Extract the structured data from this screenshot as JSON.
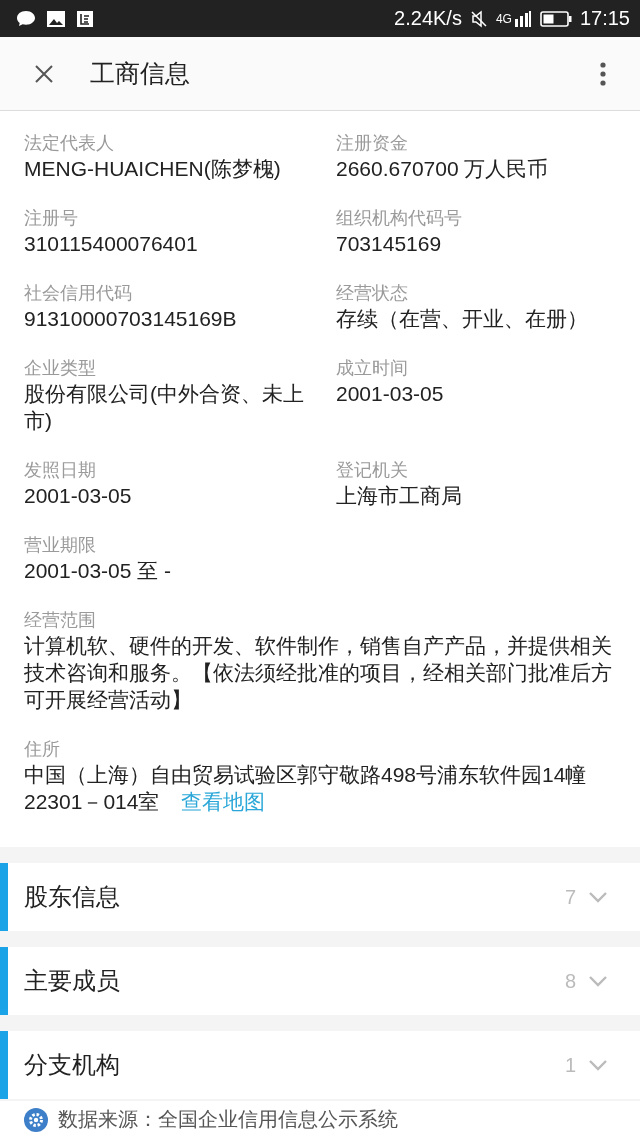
{
  "status_bar": {
    "speed": "2.24K/s",
    "network": "4G",
    "time": "17:15"
  },
  "header": {
    "title": "工商信息"
  },
  "fields": [
    {
      "kind": "half",
      "label": "法定代表人",
      "value": "MENG-HUAICHEN(陈梦槐)"
    },
    {
      "kind": "half",
      "label": "注册资金",
      "value": "2660.670700 万人民币"
    },
    {
      "kind": "half",
      "label": "注册号",
      "value": "310115400076401"
    },
    {
      "kind": "half",
      "label": "组织机构代码号",
      "value": "703145169"
    },
    {
      "kind": "half",
      "label": "社会信用代码",
      "value": "91310000703145169B"
    },
    {
      "kind": "half",
      "label": "经营状态",
      "value": "存续（在营、开业、在册）"
    },
    {
      "kind": "half",
      "label": "企业类型",
      "value": "股份有限公司(中外合资、未上市)"
    },
    {
      "kind": "half",
      "label": "成立时间",
      "value": "2001-03-05"
    },
    {
      "kind": "half",
      "label": "发照日期",
      "value": "2001-03-05"
    },
    {
      "kind": "half",
      "label": "登记机关",
      "value": "上海市工商局"
    },
    {
      "kind": "wide",
      "label": "营业期限",
      "value": "2001-03-05 至 -"
    },
    {
      "kind": "wide",
      "label": "经营范围",
      "value": "计算机软、硬件的开发、软件制作，销售自产产品，并提供相关技术咨询和服务。【依法须经批准的项目，经相关部门批准后方可开展经营活动】"
    },
    {
      "kind": "address",
      "label": "住所",
      "lines": [
        "中国（上海）自由贸易试验区郭守敬路498号浦东软件园14幢",
        "22301－014室"
      ],
      "link": "查看地图"
    }
  ],
  "sections": [
    {
      "title": "股东信息",
      "count": "7"
    },
    {
      "title": "主要成员",
      "count": "8"
    },
    {
      "title": "分支机构",
      "count": "1"
    }
  ],
  "footer": {
    "text": "数据来源：全国企业信用信息公示系统"
  }
}
